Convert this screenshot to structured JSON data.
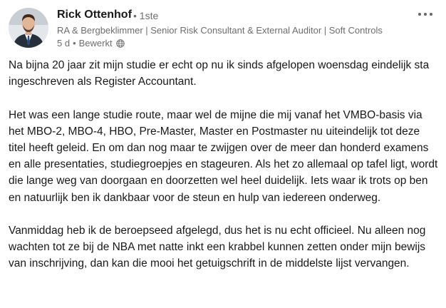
{
  "author": {
    "name": "Rick Ottenhof",
    "degree": "• 1ste",
    "headline": "RA & Bergbeklimmer | Senior Risk Consultant & External Auditor | Soft Controls",
    "time": "5 d",
    "separator": "•",
    "edited": "Bewerkt",
    "visibility_icon": "globe-icon"
  },
  "post": {
    "paragraph_1": "Na bijna 20 jaar zit mijn studie er echt op nu ik sinds afgelopen woensdag eindelijk sta ingeschreven als Register Accountant.",
    "paragraph_2": "Het was een lange studie route, maar wel de mijne die mij vanaf het VMBO-basis via het MBO-2, MBO-4, HBO, Pre-Master, Master en Postmaster nu uiteindelijk tot deze titel heeft geleid. En om dan nog maar te zwijgen over de meer dan honderd examens en alle presentaties, studiegroepjes en stageuren. Als het zo allemaal op tafel ligt, wordt die lange weg van doorgaan en doorzetten wel heel duidelijk. Iets waar ik trots op ben en natuurlijk ben ik dankbaar voor de steun en hulp van iedereen onderweg.",
    "paragraph_3": "Vanmiddag heb ik de beroepseed afgelegd, dus het is nu echt officieel. Nu alleen nog wachten tot ze bij de NBA met natte inkt een krabbel kunnen zetten onder mijn bewijs van inschrijving, dan kan die mooi het getuigschrift in de middelste lijst vervangen."
  },
  "colors": {
    "text": "#191919",
    "muted": "#6e6e6e",
    "background": "#ffffff"
  }
}
